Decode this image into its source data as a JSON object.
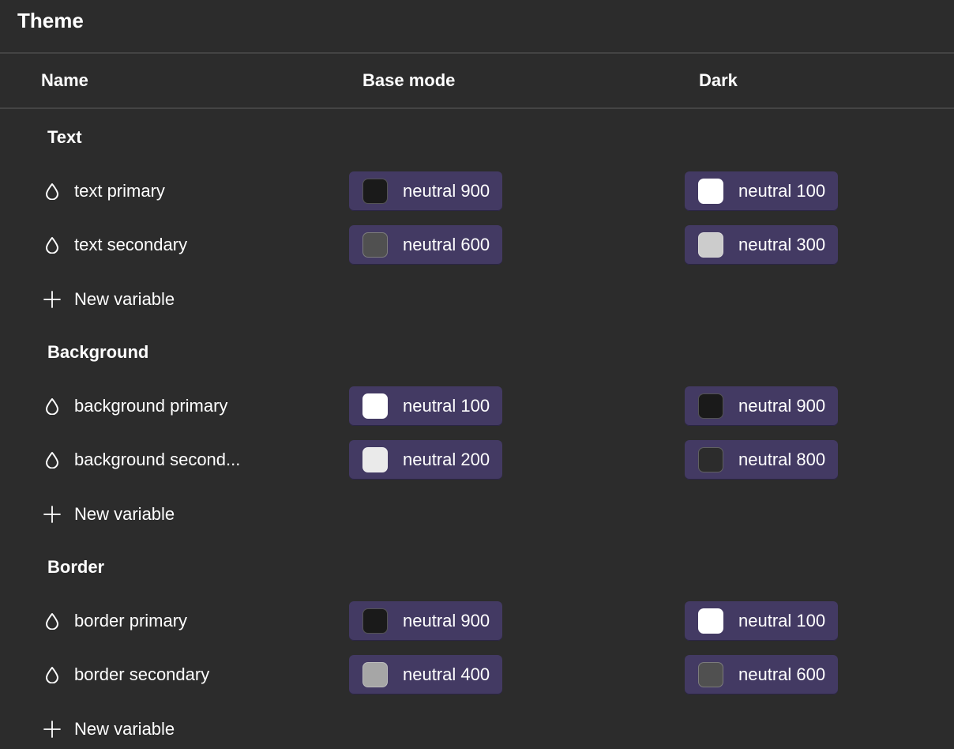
{
  "panel": {
    "title": "Theme"
  },
  "columns": {
    "name": "Name",
    "base": "Base mode",
    "dark": "Dark"
  },
  "icons": {
    "variable": "color-drop-icon",
    "add": "plus-icon"
  },
  "groups": [
    {
      "title": "Text",
      "new_variable_label": "New variable",
      "variables": [
        {
          "name": "text primary",
          "base": {
            "label": "neutral 900",
            "color": "#1a1a1a"
          },
          "dark": {
            "label": "neutral 100",
            "color": "#ffffff"
          }
        },
        {
          "name": "text secondary",
          "base": {
            "label": "neutral 600",
            "color": "#505050"
          },
          "dark": {
            "label": "neutral 300",
            "color": "#cccccc"
          }
        }
      ]
    },
    {
      "title": "Background",
      "new_variable_label": "New variable",
      "variables": [
        {
          "name": "background primary",
          "base": {
            "label": "neutral 100",
            "color": "#ffffff"
          },
          "dark": {
            "label": "neutral 900",
            "color": "#1a1a1a"
          }
        },
        {
          "name": "background second...",
          "base": {
            "label": "neutral 200",
            "color": "#eaeaea"
          },
          "dark": {
            "label": "neutral 800",
            "color": "#2c2c2c"
          }
        }
      ]
    },
    {
      "title": "Border",
      "new_variable_label": "New variable",
      "variables": [
        {
          "name": "border primary",
          "base": {
            "label": "neutral 900",
            "color": "#1a1a1a"
          },
          "dark": {
            "label": "neutral 100",
            "color": "#ffffff"
          }
        },
        {
          "name": "border secondary",
          "base": {
            "label": "neutral 400",
            "color": "#a6a6a6"
          },
          "dark": {
            "label": "neutral 600",
            "color": "#505050"
          }
        }
      ]
    }
  ],
  "colors": {
    "background": "#2c2c2c",
    "divider": "#444444",
    "chip": "#433a63",
    "text": "#ffffff"
  }
}
